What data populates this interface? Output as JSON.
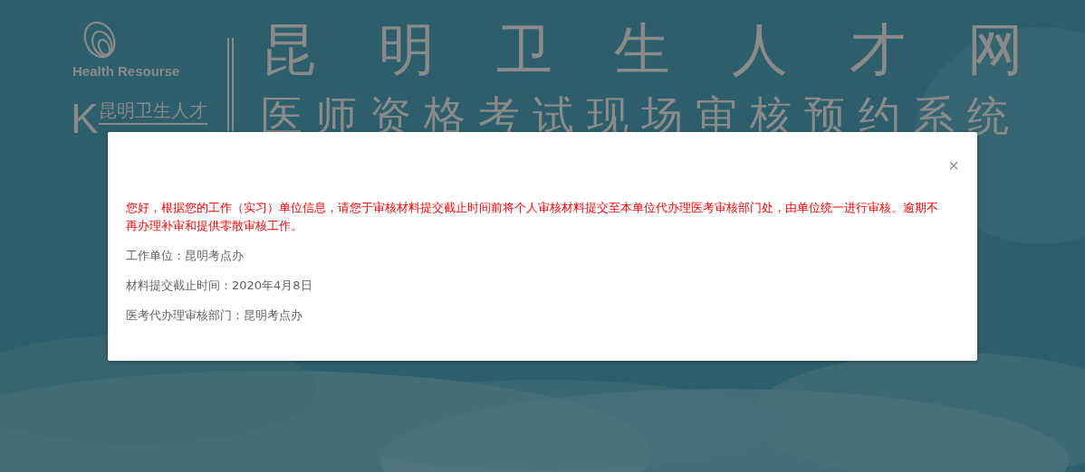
{
  "header": {
    "logo": {
      "tagline": "Health Resourse",
      "letter": "K",
      "name": "昆明卫生人才"
    },
    "title": "昆明卫生人才网",
    "subtitle": "医师资格考试现场审核预约系统"
  },
  "dialog": {
    "close": "×",
    "notice": "您好，根据您的工作（实习）单位信息，请您于审核材料提交截止时间前将个人审核材料提交至本单位代办理医考审核部门处，由单位统一进行审核。逾期不再办理补审和提供零散审核工作。",
    "lines": [
      "工作单位：昆明考点办",
      "材料提交截止时间：2020年4月8日",
      "医考代办理审核部门：昆明考点办"
    ]
  }
}
